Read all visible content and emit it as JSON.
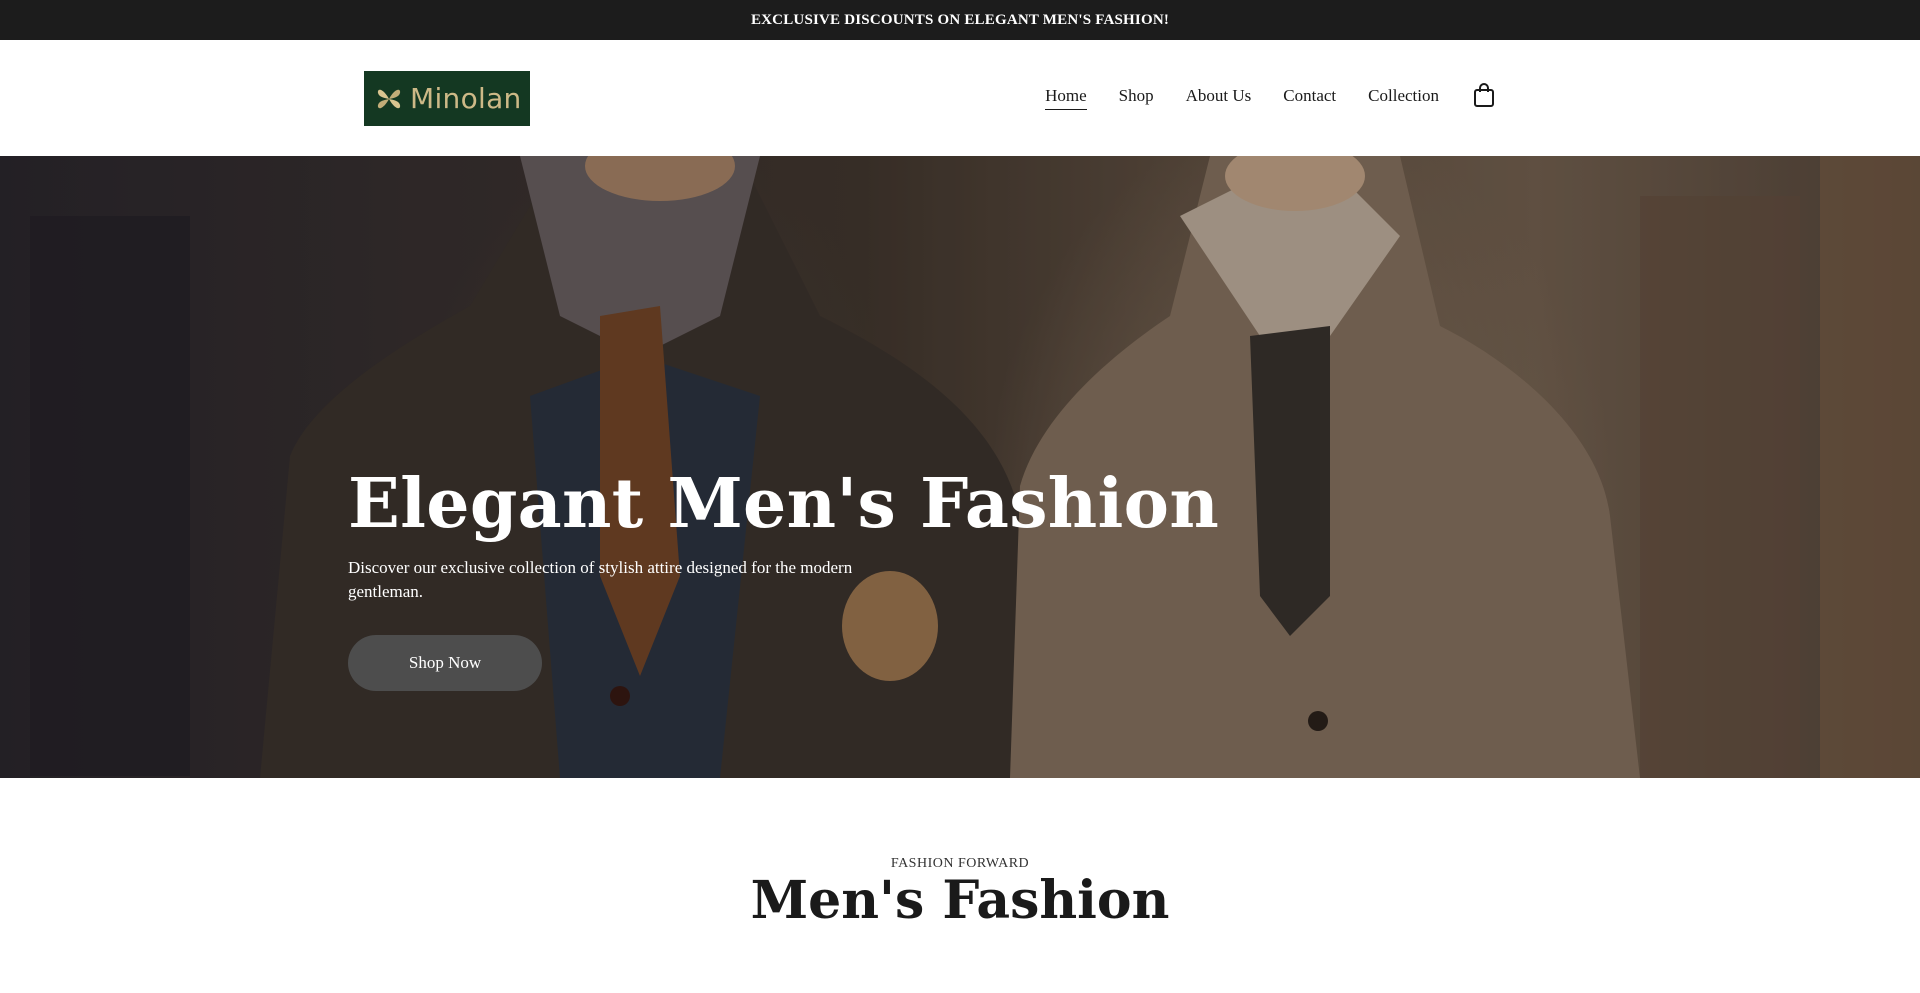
{
  "announcement": {
    "text": "EXCLUSIVE DISCOUNTS ON ELEGANT MEN'S FASHION!"
  },
  "brand": {
    "name": "Minolan"
  },
  "nav": {
    "items": [
      {
        "label": "Home",
        "active": true
      },
      {
        "label": "Shop",
        "active": false
      },
      {
        "label": "About Us",
        "active": false
      },
      {
        "label": "Contact",
        "active": false
      },
      {
        "label": "Collection",
        "active": false
      }
    ],
    "cart_icon": "shopping-bag-icon"
  },
  "hero": {
    "title": "Elegant Men's Fashion",
    "subtitle": "Discover our exclusive collection of stylish attire designed for the modern gentleman.",
    "cta_label": "Shop Now",
    "image": "mannequins-in-tweed-and-check-jackets"
  },
  "section": {
    "eyebrow": "FASHION FORWARD",
    "title": "Men's Fashion"
  },
  "colors": {
    "announcement_bg": "#1c1c1c",
    "logo_bg": "#143822",
    "logo_gold": "#cdb987",
    "button_bg": "#4d4d4d",
    "text_dark": "#1a1a1a"
  }
}
